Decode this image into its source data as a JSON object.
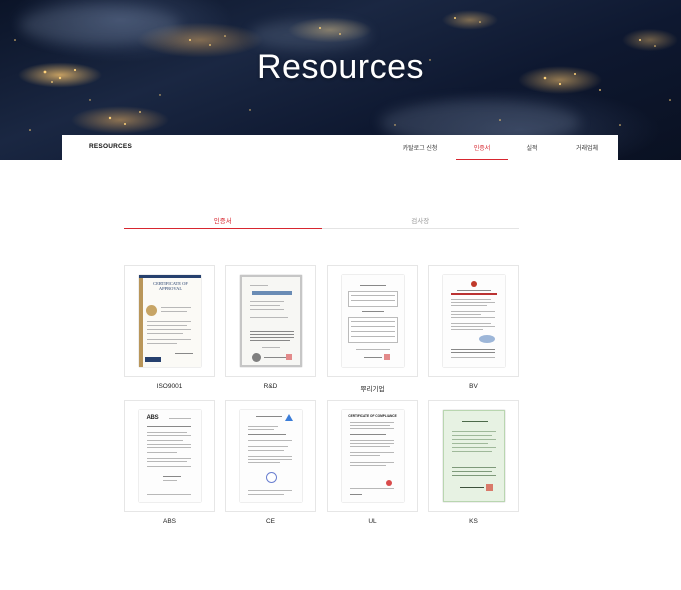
{
  "hero": {
    "title": "Resources"
  },
  "subnav": {
    "section_label": "RESOURCES",
    "menu": [
      {
        "label": "카탈로그 신청",
        "active": false
      },
      {
        "label": "인증서",
        "active": true
      },
      {
        "label": "실적",
        "active": false
      },
      {
        "label": "거래업체",
        "active": false
      }
    ]
  },
  "tabs": [
    {
      "label": "인증서",
      "active": true
    },
    {
      "label": "검사장",
      "active": false
    }
  ],
  "certificates": [
    {
      "label": "ISO9001",
      "doc_title": "CERTIFICATE OF APPROVAL"
    },
    {
      "label": "R&D"
    },
    {
      "label": "뿌리기업"
    },
    {
      "label": "BV"
    },
    {
      "label": "ABS",
      "doc_title": "ABS"
    },
    {
      "label": "CE"
    },
    {
      "label": "UL",
      "doc_title": "CERTIFICATE OF COMPLIANCE"
    },
    {
      "label": "KS"
    }
  ],
  "colors": {
    "accent": "#d7262f",
    "hero_dark": "#0b1428"
  }
}
